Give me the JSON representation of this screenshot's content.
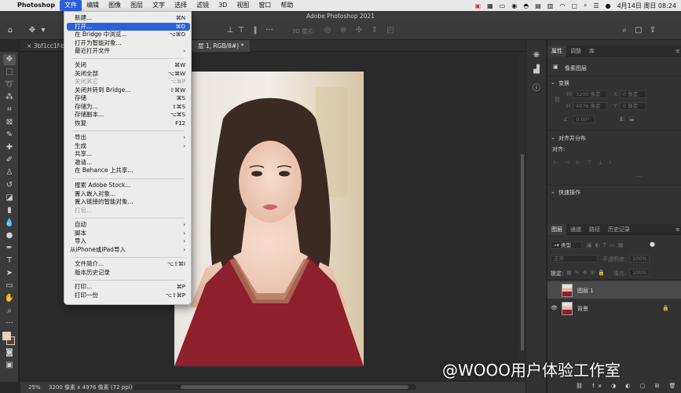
{
  "menubar": {
    "app": "Photoshop",
    "items": [
      "文件",
      "编辑",
      "图像",
      "图层",
      "文字",
      "选择",
      "滤镜",
      "3D",
      "视图",
      "窗口",
      "帮助"
    ],
    "clock": "4月14日 周日 08:24"
  },
  "window": {
    "title": "Adobe Photoshop 2021"
  },
  "tabs": [
    {
      "label": "3bf1cc1f-b"
    },
    {
      "label": "层 1, RGB/8#) *"
    }
  ],
  "options_bar": {
    "three_d_mode": "3D 模式:"
  },
  "file_menu": {
    "items": [
      {
        "label": "新建...",
        "shortcut": "⌘N"
      },
      {
        "label": "打开...",
        "shortcut": "⌘O"
      },
      {
        "label": "在 Bridge 中浏览...",
        "shortcut": "⌥⌘O"
      },
      {
        "label": "打开为智能对象..."
      },
      {
        "label": "最近打开文件",
        "submenu": true
      },
      {
        "label": "关闭",
        "shortcut": "⌘W"
      },
      {
        "label": "关闭全部",
        "shortcut": "⌥⌘W"
      },
      {
        "label": "关闭其它",
        "shortcut": "⌥⌘P"
      },
      {
        "label": "关闭并转到 Bridge...",
        "shortcut": "⇧⌘W"
      },
      {
        "label": "存储",
        "shortcut": "⌘S"
      },
      {
        "label": "存储为...",
        "shortcut": "⇧⌘S"
      },
      {
        "label": "存储副本...",
        "shortcut": "⌥⌘S"
      },
      {
        "label": "恢复",
        "shortcut": "F12"
      },
      {
        "label": "导出",
        "submenu": true
      },
      {
        "label": "生成",
        "submenu": true
      },
      {
        "label": "共享..."
      },
      {
        "label": "邀请..."
      },
      {
        "label": "在 Behance 上共享..."
      },
      {
        "label": "搜索 Adobe Stock..."
      },
      {
        "label": "置入嵌入对象..."
      },
      {
        "label": "置入链接的智能对象..."
      },
      {
        "label": "打包..."
      },
      {
        "label": "自动",
        "submenu": true
      },
      {
        "label": "脚本",
        "submenu": true
      },
      {
        "label": "导入",
        "submenu": true
      },
      {
        "label": "从iPhone或iPad导入",
        "submenu": true
      },
      {
        "label": "文件简介...",
        "shortcut": "⌥⇧⌘I"
      },
      {
        "label": "版本历史记录"
      },
      {
        "label": "打印...",
        "shortcut": "⌘P"
      },
      {
        "label": "打印一份",
        "shortcut": "⌥⇧⌘P"
      }
    ]
  },
  "properties_panel": {
    "tabs": [
      "属性",
      "调整",
      "库"
    ],
    "layer_type": "像素图层",
    "transform_title": "变换",
    "w_label": "W",
    "w_value": "3200 像素",
    "h_label": "H",
    "h_value": "4976 像素",
    "x_label": "X",
    "x_value": "0 像素",
    "y_label": "Y",
    "y_value": "0 像素",
    "angle_value": "0.00°",
    "align_title": "对齐并分布",
    "align_label": "对齐:",
    "quick_actions": "快速操作"
  },
  "layers_panel": {
    "tabs": [
      "图层",
      "通道",
      "路径",
      "历史记录"
    ],
    "filter_kind": "类型",
    "blend_mode": "正常",
    "opacity_label": "不透明度:",
    "opacity_value": "100%",
    "lock_label": "锁定:",
    "fill_label": "填充:",
    "fill_value": "100%",
    "layers": [
      {
        "name": "图层 1"
      },
      {
        "name": "背景"
      }
    ]
  },
  "status": {
    "zoom": "25%",
    "doc_info": "3200 像素 x 4976 像素 (72 ppi)"
  },
  "watermark": "@WOOO用户体验工作室"
}
